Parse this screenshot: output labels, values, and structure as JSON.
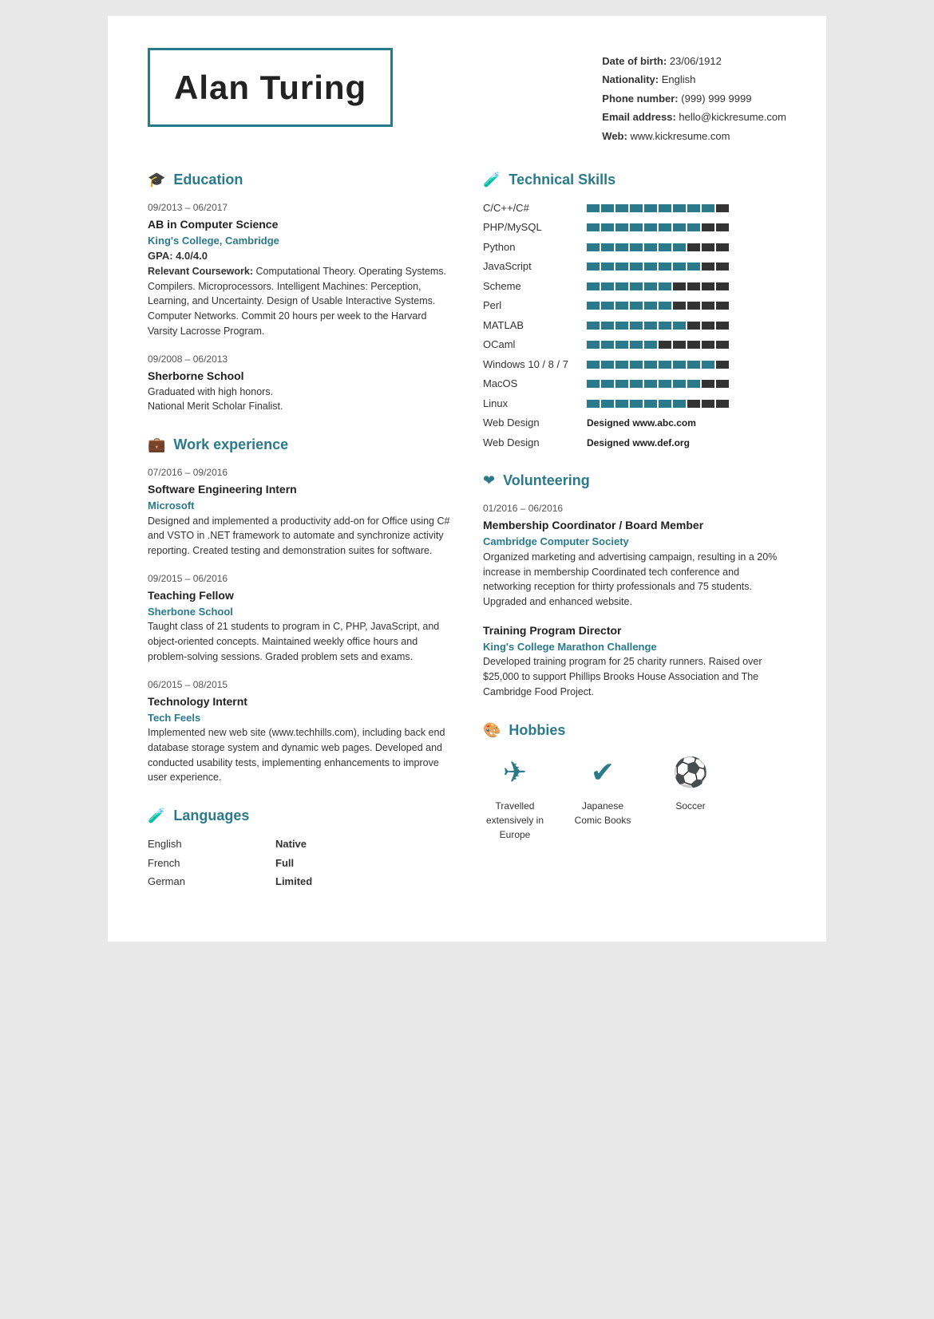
{
  "header": {
    "name": "Alan Turing",
    "dob_label": "Date of birth:",
    "dob": "23/06/1912",
    "nationality_label": "Nationality:",
    "nationality": "English",
    "phone_label": "Phone number:",
    "phone": "(999) 999 9999",
    "email_label": "Email address:",
    "email": "hello@kickresume.com",
    "web_label": "Web:",
    "web": "www.kickresume.com"
  },
  "education": {
    "section_title": "Education",
    "entries": [
      {
        "date": "09/2013 – 06/2017",
        "title": "AB in Computer Science",
        "org": "King's College, Cambridge",
        "gpa_label": "GPA:",
        "gpa": "4.0/4.0",
        "coursework_label": "Relevant Coursework:",
        "desc": "Computational Theory. Operating Systems. Compilers. Microprocessors. Intelligent Machines: Perception, Learning, and Uncertainty. Design of Usable Interactive Systems. Computer Networks. Commit 20 hours per week to the Harvard Varsity Lacrosse Program."
      },
      {
        "date": "09/2008 – 06/2013",
        "title": "Sherborne School",
        "org": "",
        "desc": "Graduated with high honors.\nNational Merit Scholar Finalist."
      }
    ]
  },
  "work": {
    "section_title": "Work experience",
    "entries": [
      {
        "date": "07/2016 – 09/2016",
        "title": "Software Engineering Intern",
        "org": "Microsoft",
        "desc": "Designed and implemented a productivity add-on for Office using C# and VSTO in .NET framework to automate and synchronize activity reporting. Created testing and demonstration suites for software."
      },
      {
        "date": "09/2015 – 06/2016",
        "title": "Teaching Fellow",
        "org": "Sherbone School",
        "desc": "Taught class of 21 students to program in C, PHP, JavaScript, and object-oriented concepts. Maintained weekly office hours and problem-solving sessions. Graded problem sets and exams."
      },
      {
        "date": "06/2015 – 08/2015",
        "title": "Technology Internt",
        "org": "Tech Feels",
        "desc": "Implemented new web site (www.techhills.com), including back end database storage system and dynamic web pages. Developed and conducted usability tests, implementing enhancements to improve user experience."
      }
    ]
  },
  "languages": {
    "section_title": "Languages",
    "entries": [
      {
        "language": "English",
        "level": "Native"
      },
      {
        "language": "French",
        "level": "Full"
      },
      {
        "language": "German",
        "level": "Limited"
      }
    ]
  },
  "technical_skills": {
    "section_title": "Technical Skills",
    "skills": [
      {
        "name": "C/C++/C#",
        "filled": 9,
        "total": 10,
        "text": ""
      },
      {
        "name": "PHP/MySQL",
        "filled": 8,
        "total": 10,
        "text": ""
      },
      {
        "name": "Python",
        "filled": 7,
        "total": 10,
        "text": ""
      },
      {
        "name": "JavaScript",
        "filled": 8,
        "total": 10,
        "text": ""
      },
      {
        "name": "Scheme",
        "filled": 6,
        "total": 10,
        "text": ""
      },
      {
        "name": "Perl",
        "filled": 6,
        "total": 10,
        "text": ""
      },
      {
        "name": "MATLAB",
        "filled": 7,
        "total": 10,
        "text": ""
      },
      {
        "name": "OCaml",
        "filled": 5,
        "total": 10,
        "text": ""
      },
      {
        "name": "Windows 10 / 8 / 7",
        "filled": 9,
        "total": 10,
        "text": ""
      },
      {
        "name": "MacOS",
        "filled": 8,
        "total": 10,
        "text": ""
      },
      {
        "name": "Linux",
        "filled": 7,
        "total": 10,
        "text": ""
      },
      {
        "name": "Web Design",
        "filled": 0,
        "total": 0,
        "text": "Designed www.abc.com"
      },
      {
        "name": "Web Design",
        "filled": 0,
        "total": 0,
        "text": "Designed www.def.org"
      }
    ]
  },
  "volunteering": {
    "section_title": "Volunteering",
    "entries": [
      {
        "date": "01/2016 – 06/2016",
        "title": "Membership Coordinator / Board Member",
        "org": "Cambridge Computer Society",
        "desc": "Organized marketing and advertising campaign, resulting in a 20% increase in membership Coordinated tech conference and networking reception for thirty professionals and 75 students. Upgraded and enhanced website."
      },
      {
        "date": "",
        "title": "Training Program Director",
        "org": "King's College Marathon Challenge",
        "desc": "Developed training program for 25 charity runners. Raised over $25,000 to support Phillips Brooks House Association and The Cambridge Food Project."
      }
    ]
  },
  "hobbies": {
    "section_title": "Hobbies",
    "items": [
      {
        "label": "Travelled extensively in Europe",
        "icon": "✈"
      },
      {
        "label": "Japanese Comic Books",
        "icon": "✔"
      },
      {
        "label": "Soccer",
        "icon": "⚽"
      }
    ]
  }
}
